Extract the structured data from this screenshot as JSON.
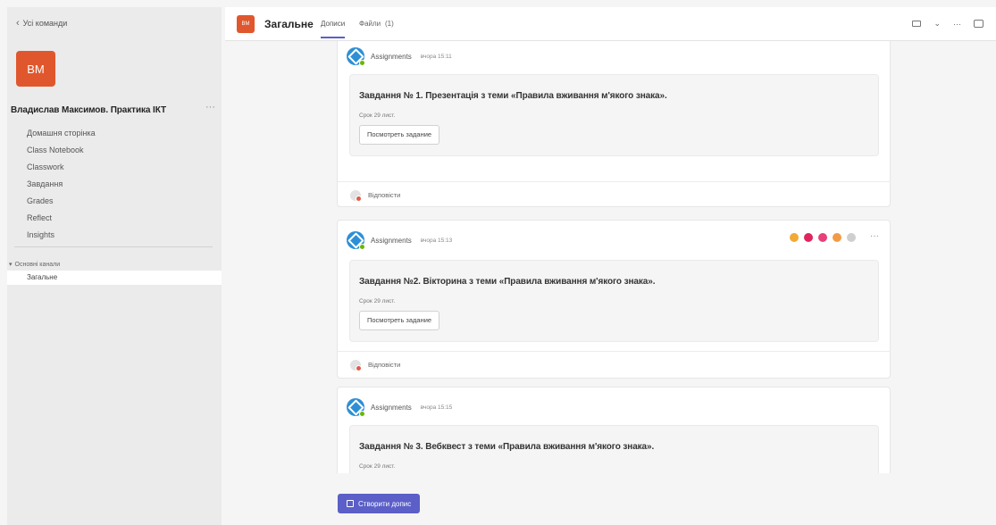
{
  "sidebar": {
    "back_label": "Усі команди",
    "team_initials": "ВМ",
    "team_name": "Владислав Максимов. Практика ІКТ",
    "more_label": "···",
    "nav_items": [
      "Домашня сторінка",
      "Class Notebook",
      "Classwork",
      "Завдання",
      "Grades",
      "Reflect",
      "Insights"
    ],
    "channels_heading": "Основні канали",
    "channel_active": "Загальне"
  },
  "header": {
    "channel_initials": "ВМ",
    "channel_title": "Загальне",
    "tabs": [
      "Дописи",
      "Файли",
      "(1)"
    ],
    "icons": [
      "video-camera-icon",
      "chevron-down-icon",
      "more-icon",
      "panel-icon"
    ]
  },
  "posts": [
    {
      "sender": "Assignments",
      "time": "вчора 15:11",
      "title": "Завдання № 1. Презентація з теми «Правила вживання м'якого знака».",
      "due": "Срок 29 лист.",
      "button": "Посмотреть задание",
      "reply": "Відповісти",
      "reactions": []
    },
    {
      "sender": "Assignments",
      "time": "вчора 15:13",
      "title": "Завдання №2. Вікторина з теми «Правила вживання м'якого знака».",
      "due": "Срок 29 лист.",
      "button": "Посмотреть задание",
      "reply": "Відповісти",
      "reactions": [
        {
          "name": "thumbs-up-icon",
          "color": "#f2a935"
        },
        {
          "name": "heart-icon",
          "color": "#e0245e"
        },
        {
          "name": "laugh-icon",
          "color": "#e8407a"
        },
        {
          "name": "surprised-icon",
          "color": "#f29b45"
        },
        {
          "name": "add-reaction-icon",
          "color": "#9a9a9a"
        }
      ]
    },
    {
      "sender": "Assignments",
      "time": "вчора 15:15",
      "title": "Завдання № 3. Вебквест з теми «Правила вживання м'якого знака».",
      "due": "Срок 29 лист."
    }
  ],
  "compose": {
    "new_post_label": "Створити допис"
  },
  "colors": {
    "accent": "#5b5fc7",
    "team_avatar": "#e0572d",
    "app_icon": "#2e8fd6"
  }
}
